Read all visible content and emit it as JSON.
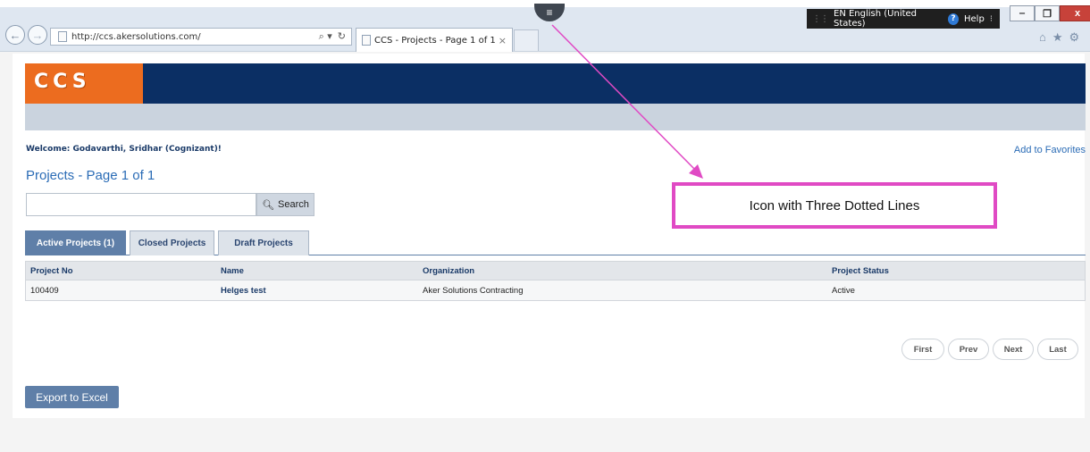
{
  "browser": {
    "address": "http://ccs.akersolutions.com/",
    "tab_title": "CCS - Projects - Page 1 of 1",
    "tab_close": "×",
    "search_glyph": "⌕ ▾",
    "refresh_glyph": "↻",
    "language": "EN English (United States)",
    "help": "Help",
    "lang_more": "⁝",
    "menu_glyph": "≡",
    "back_glyph": "←",
    "forward_glyph": "→",
    "minimize": "‒",
    "restore": "❐",
    "close": "x",
    "home_glyph": "⌂",
    "fav_glyph": "★",
    "settings_glyph": "⚙"
  },
  "app": {
    "logo": "CCS",
    "welcome": "Welcome:  Godavarthi, Sridhar (Cognizant)!",
    "add_to_favorites": "Add to Favorites",
    "page_title": "Projects - Page 1 of 1",
    "search_button": "Search",
    "search_value": "",
    "tabs": [
      {
        "label": "Active Projects (1)",
        "active": true
      },
      {
        "label": "Closed Projects",
        "active": false
      },
      {
        "label": "Draft Projects",
        "active": false
      }
    ],
    "table": {
      "headers": [
        "Project No",
        "Name",
        "Organization",
        "Project Status"
      ],
      "rows": [
        [
          "100409",
          "Helges test",
          "Aker Solutions Contracting",
          "Active"
        ]
      ]
    },
    "pager": {
      "first": "First",
      "prev": "Prev",
      "next": "Next",
      "last": "Last"
    },
    "export_button": "Export to Excel"
  },
  "annotation": {
    "text": "Icon with Three Dotted Lines",
    "color": "#e04ac4"
  },
  "colors": {
    "brand_orange": "#ec6c1f",
    "brand_navy": "#0b2f64",
    "accent_blue": "#5f7fa8",
    "link_blue": "#2b6cb6"
  }
}
